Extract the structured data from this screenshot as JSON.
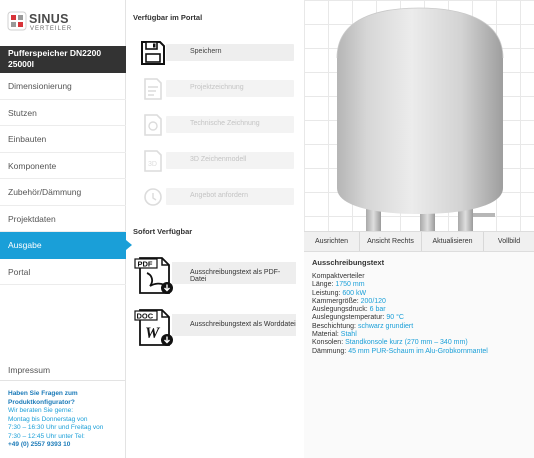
{
  "brand": {
    "name": "SINUS",
    "sub": "VERTEILER",
    "accent": "#1a9fd8",
    "logo_red": "#d8343a"
  },
  "product": {
    "line1": "Pufferspeicher DN2200",
    "line2": "25000l"
  },
  "nav": {
    "items": [
      {
        "label": "Dimensionierung"
      },
      {
        "label": "Stutzen"
      },
      {
        "label": "Einbauten"
      },
      {
        "label": "Komponente"
      },
      {
        "label": "Zubehör/Dämmung"
      },
      {
        "label": "Projektdaten"
      },
      {
        "label": "Ausgabe",
        "active": true
      },
      {
        "label": "Portal"
      }
    ],
    "impressum": "Impressum"
  },
  "contact": {
    "question": "Haben Sie Fragen zum Produktkonfigurator?",
    "line1": "Wir beraten Sie gerne:",
    "line2": "Montag bis Donnerstag von",
    "line3": "7:30 – 16:30 Uhr und Freitag von",
    "line4": "7:30 – 12:45 Uhr unter Tel:",
    "phone": "+49 (0) 2557 9393 10"
  },
  "portal": {
    "title": "Verfügbar im Portal",
    "actions": [
      {
        "label": "Speichern",
        "icon": "floppy-disk-icon",
        "enabled": true
      },
      {
        "label": "Projektzeichnung",
        "icon": "drawing-icon",
        "enabled": false
      },
      {
        "label": "Technische Zeichnung",
        "icon": "technical-drawing-icon",
        "enabled": false
      },
      {
        "label": "3D Zeichenmodell",
        "icon": "3d-model-icon",
        "enabled": false
      },
      {
        "label": "Angebot anfordern",
        "icon": "offer-icon",
        "enabled": false
      }
    ]
  },
  "instant": {
    "title": "Sofort Verfügbar",
    "docs": [
      {
        "label": "Ausschreibungstext als PDF-Datei",
        "badge": "PDF",
        "icon": "pdf-download-icon"
      },
      {
        "label": "Ausschreibungstext als Worddatei",
        "badge": "DOC",
        "icon": "doc-download-icon"
      }
    ]
  },
  "viewer": {
    "toolbar": [
      "Ausrichten",
      "Ansicht Rechts",
      "Aktualisieren",
      "Vollbild"
    ]
  },
  "specs": {
    "title": "Ausschreibungstext",
    "intro": "Kompaktverteiler",
    "rows": [
      {
        "key": "Länge:",
        "value": "1750 mm"
      },
      {
        "key": "Leistung:",
        "value": "600 kW"
      },
      {
        "key": "Kammergröße:",
        "value": "200/120"
      },
      {
        "key": "Auslegungsdruck:",
        "value": "6 bar"
      },
      {
        "key": "Auslegungstemperatur:",
        "value": "90 °C"
      },
      {
        "key": "Beschichtung:",
        "value": "schwarz grundiert"
      },
      {
        "key": "Material:",
        "value": "Stahl"
      },
      {
        "key": "Konsolen:",
        "value": "Standkonsole kurz (270 mm – 340 mm)"
      },
      {
        "key": "Dämmung:",
        "value": "45 mm PUR-Schaum im Alu-Grobkornmantel"
      }
    ]
  }
}
